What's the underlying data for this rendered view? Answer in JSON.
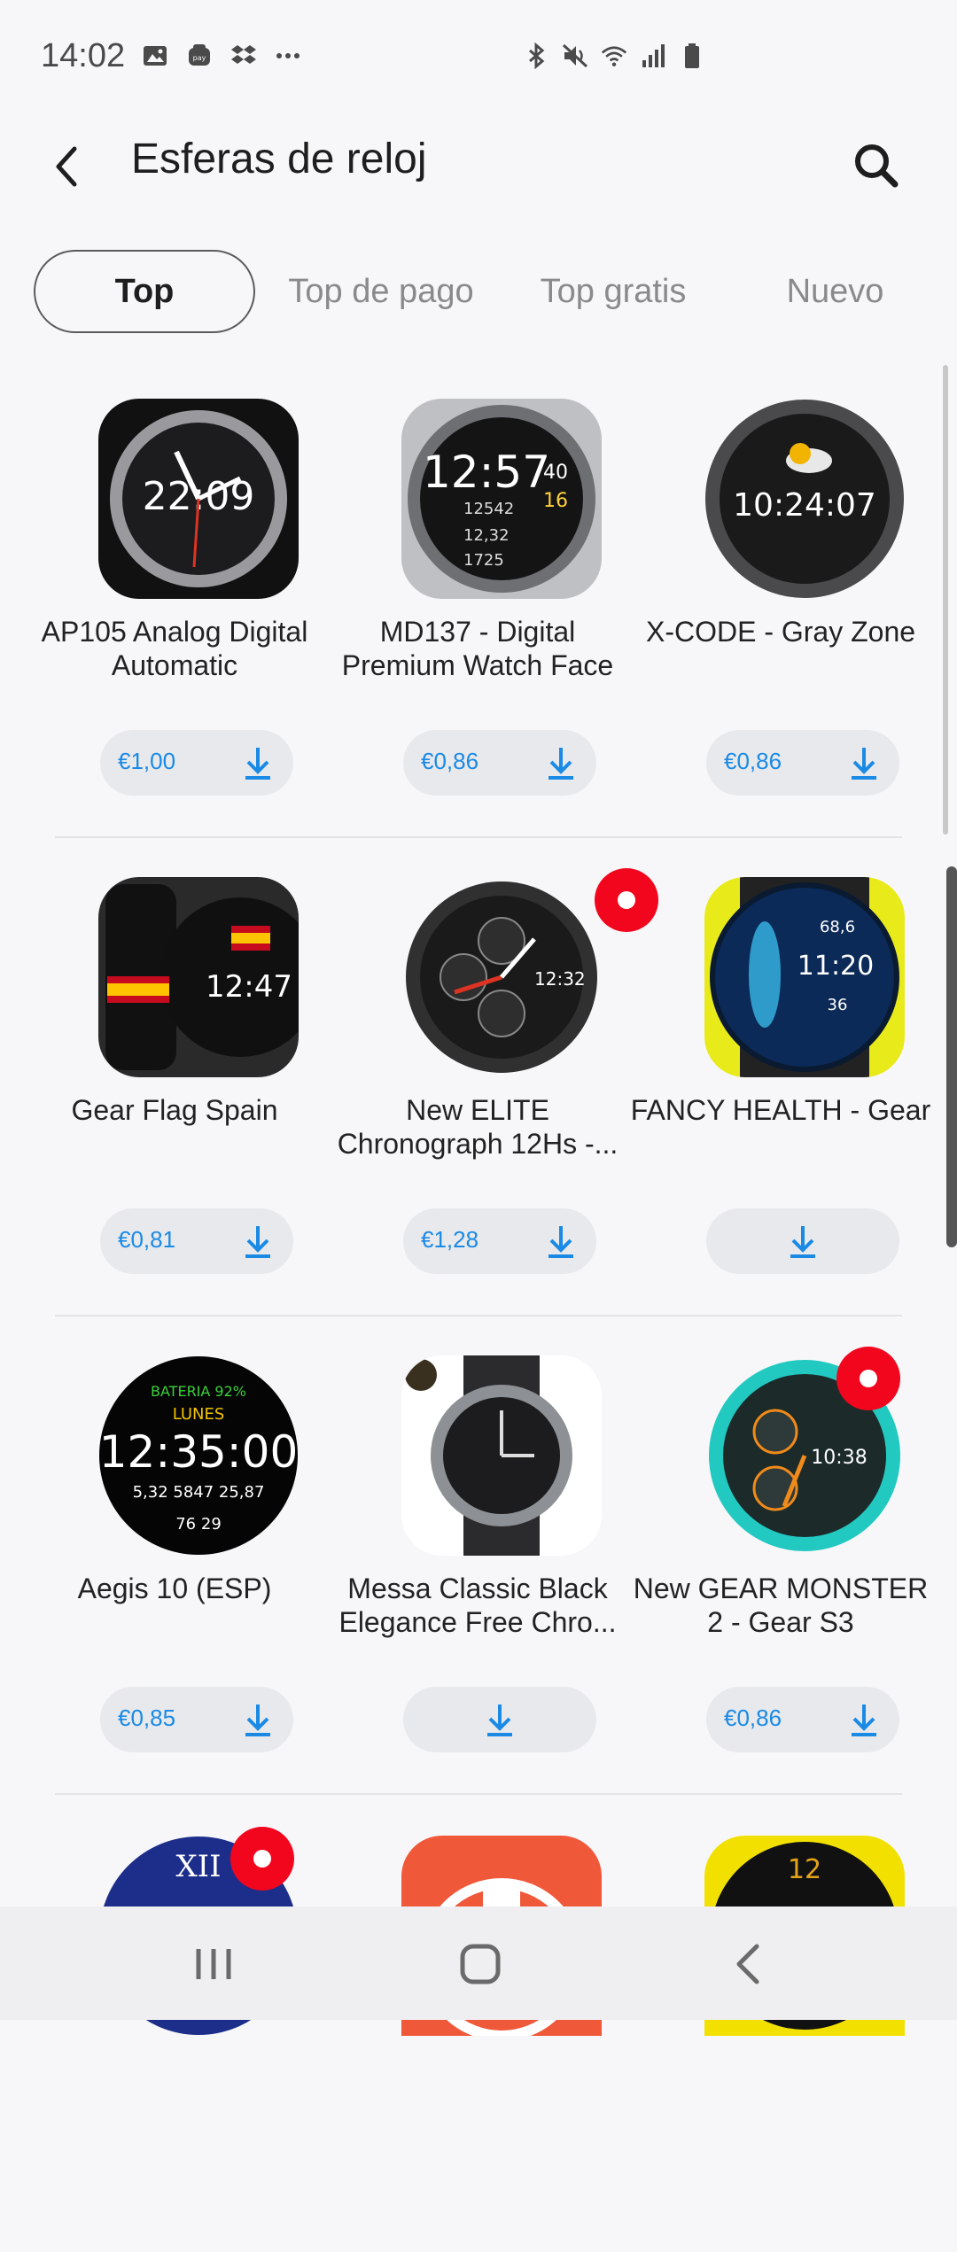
{
  "status_bar": {
    "time": "14:02",
    "left_icons": [
      "image-icon",
      "samsung-pay-icon",
      "dropbox-icon",
      "more-icon"
    ],
    "right_icons": [
      "bluetooth-icon",
      "mute-icon",
      "wifi-icon",
      "signal-icon",
      "battery-icon"
    ]
  },
  "header": {
    "title": "Esferas de reloj",
    "back_icon": "back-arrow-icon",
    "search_icon": "search-icon"
  },
  "tabs": [
    {
      "label": "Top",
      "active": true
    },
    {
      "label": "Top de pago",
      "active": false
    },
    {
      "label": "Top gratis",
      "active": false
    },
    {
      "label": "Nuevo",
      "active": false
    }
  ],
  "apps": [
    {
      "name": "AP105 Analog Digital Automatic",
      "price": "€1,00",
      "thumb_color": "#2a2a2e"
    },
    {
      "name": "MD137 - Digital Premium Watch Face",
      "price": "€0,86",
      "thumb_color": "#3a3a3e"
    },
    {
      "name": "X-CODE - Gray Zone",
      "price": "€0,86",
      "thumb_color": "#2c2c2c"
    },
    {
      "name": "Gear Flag Spain",
      "price": "€0,81",
      "thumb_color": "#202020"
    },
    {
      "name": "New ELITE Chronograph 12Hs -...",
      "price": "€1,28",
      "thumb_color": "#262626",
      "new_badge": true
    },
    {
      "name": "FANCY HEALTH - Gear",
      "price": "",
      "thumb_color": "#0c2c5a"
    },
    {
      "name": "Aegis 10 (ESP)",
      "price": "€0,85",
      "thumb_color": "#0a0a0a"
    },
    {
      "name": "Messa Classic Black Elegance Free Chro...",
      "price": "",
      "thumb_color": "#30363c"
    },
    {
      "name": "New GEAR MONSTER 2 - Gear S3",
      "price": "€0,86",
      "thumb_color": "#1b4a4a",
      "new_badge": true
    }
  ],
  "nav_bar": [
    "recents-icon",
    "home-icon",
    "back-icon"
  ]
}
